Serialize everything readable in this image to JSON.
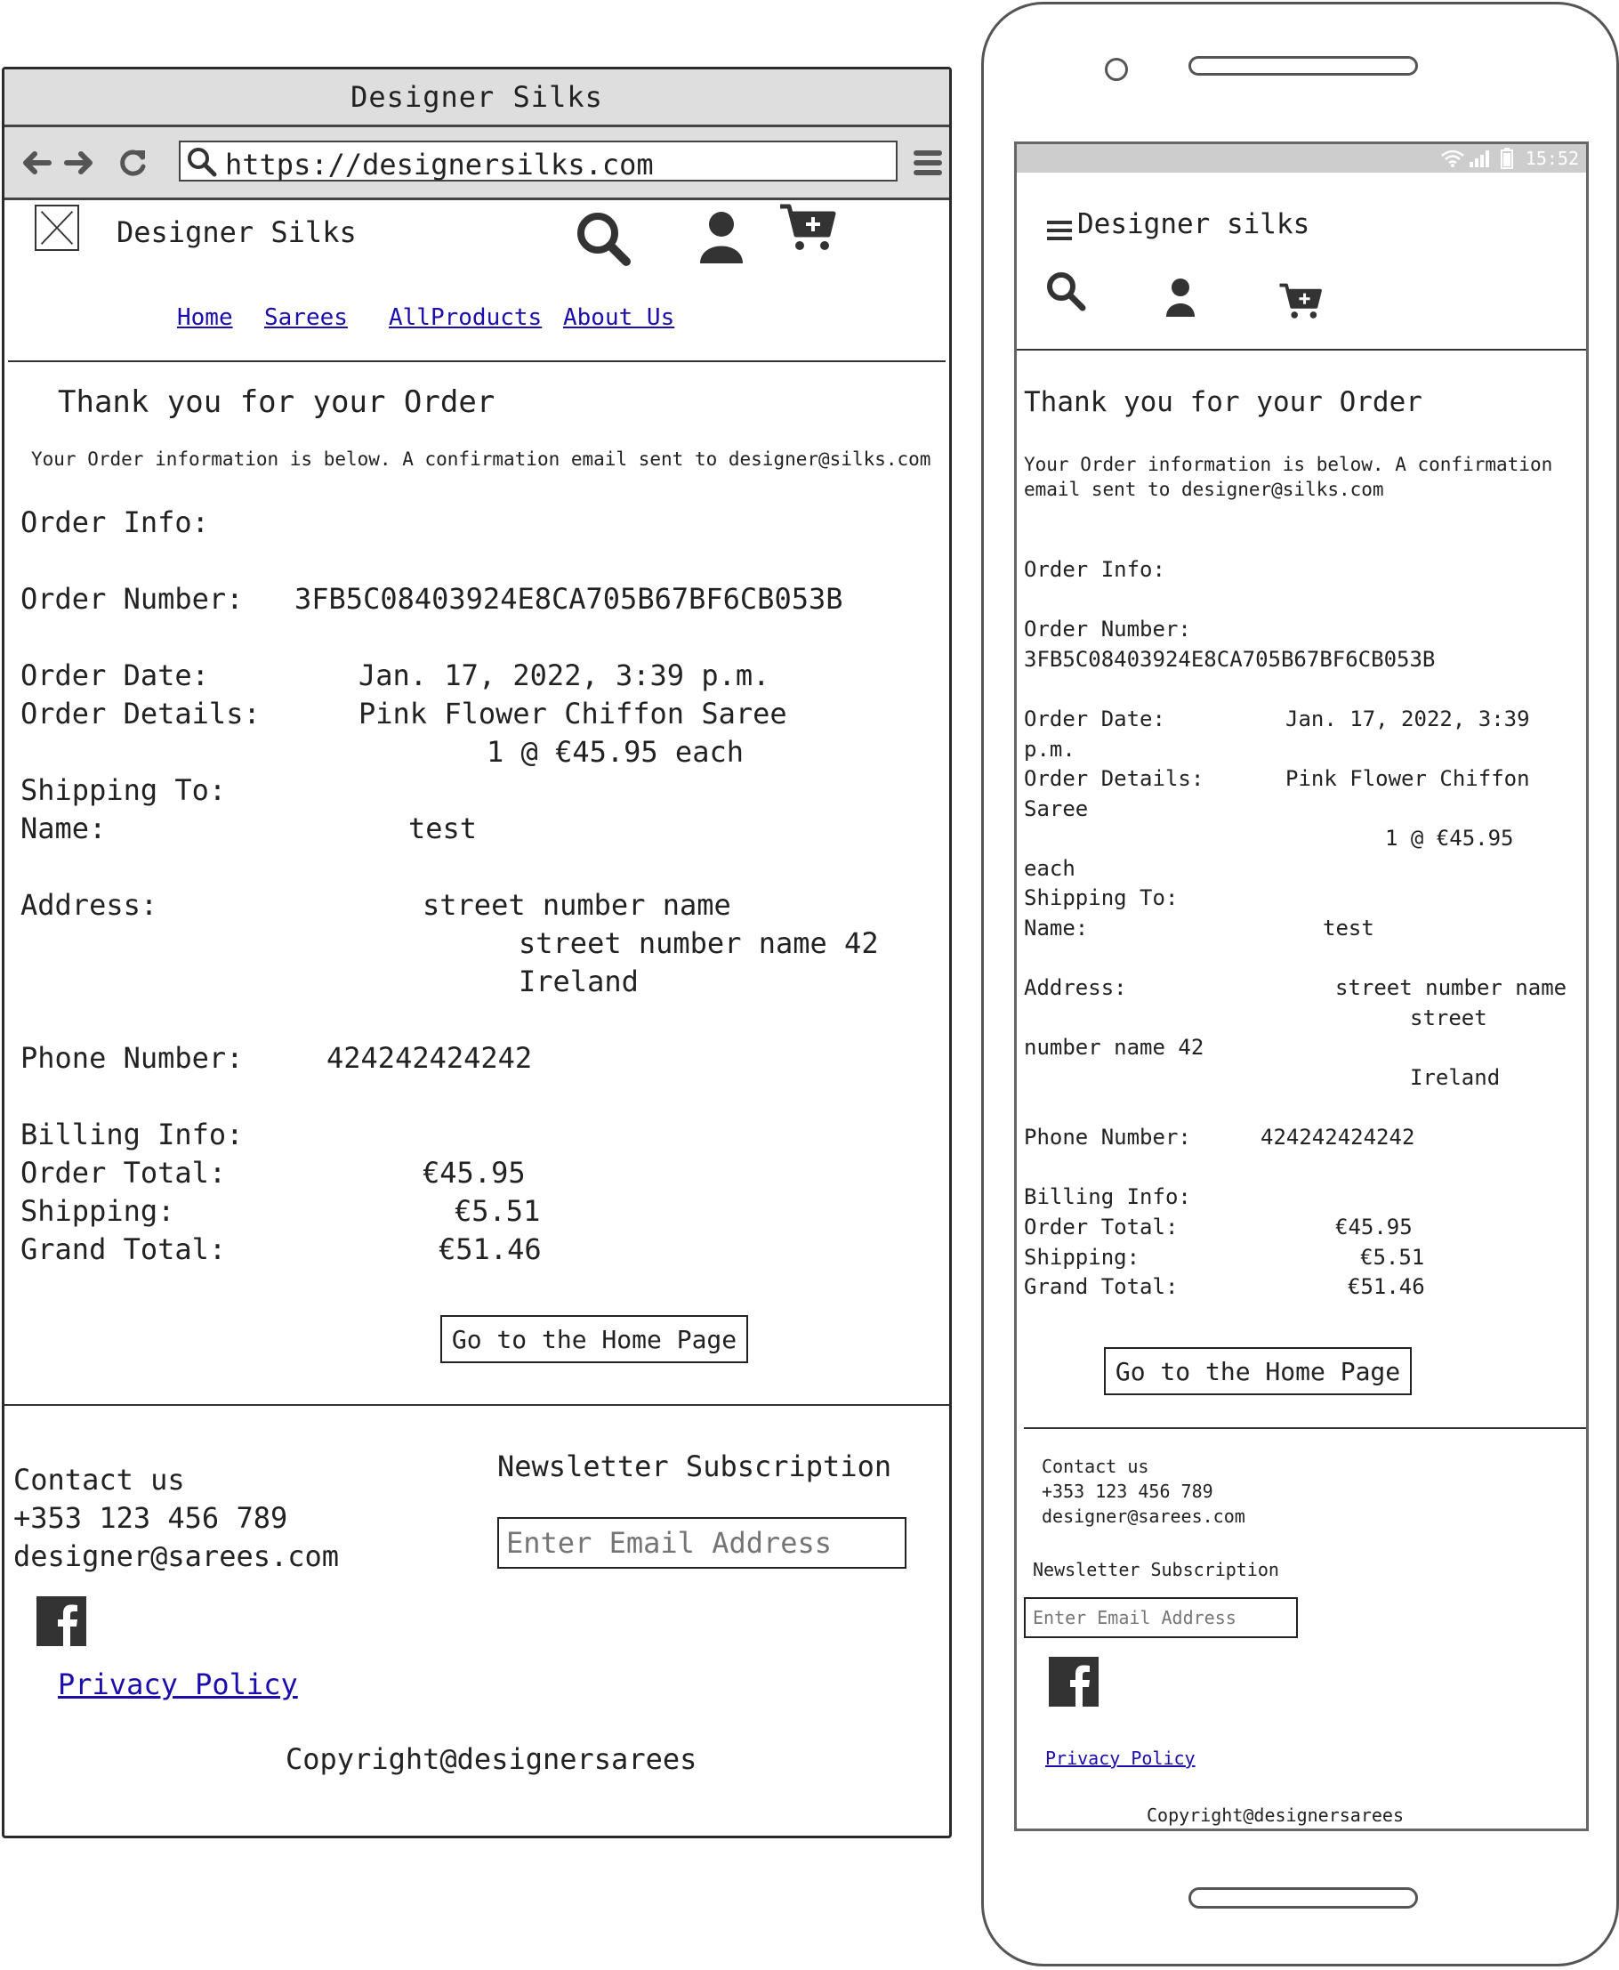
{
  "desktop": {
    "window_title": "Designer Silks",
    "url": "https://designersilks.com",
    "brand": "Designer Silks",
    "nav": [
      "Home",
      "Sarees",
      "AllProducts",
      "About Us"
    ],
    "heading": "Thank you for your Order",
    "intro": "Your Order information is below. A confirmation email sent to designer@silks.com",
    "order": {
      "info_label": "Order Info:",
      "number_label": "Order Number:",
      "number": "3FB5C08403924E8CA705B67BF6CB053B",
      "date_label": "Order Date:",
      "date": "Jan. 17, 2022, 3:39 p.m.",
      "details_label": "Order Details:",
      "item_name": "Pink Flower Chiffon Saree",
      "item_qty": "1 @ €45.95 each",
      "shipping_to_label": "Shipping To:",
      "name_label": "Name:",
      "name": "test",
      "address_label": "Address:",
      "address_line1": "street number name",
      "address_line2": "street number name 42",
      "address_line3": "Ireland",
      "phone_label": "Phone Number:",
      "phone": "424242424242",
      "billing_label": "Billing Info:",
      "total_label": "Order Total:",
      "total": "€45.95",
      "shipping_label": "Shipping:",
      "shipping": "€5.51",
      "grand_label": "Grand Total:",
      "grand": "€51.46"
    },
    "home_button": "Go to the Home Page",
    "footer": {
      "contact_title": "Contact us",
      "contact_phone": "+353 123 456 789",
      "contact_email": "designer@sarees.com",
      "newsletter_title": "Newsletter Subscription",
      "email_placeholder": "Enter Email Address",
      "privacy": "Privacy Policy",
      "copyright": "Copyright@designersarees"
    }
  },
  "mobile": {
    "time": "15:52",
    "brand": "Designer silks",
    "heading": "Thank you for your Order",
    "intro_line1": "Your Order information is below. A confirmation",
    "intro_line2": "email sent to designer@silks.com",
    "order": {
      "info_label": "Order Info:",
      "number_label": "Order Number:",
      "number": "3FB5C08403924E8CA705B67BF6CB053B",
      "date_label": "Order Date:",
      "date_part1": "Jan. 17, 2022, 3:39",
      "date_part2": "p.m.",
      "details_label": "Order Details:",
      "item_part1": "Pink Flower Chiffon",
      "item_part2": "Saree",
      "qty_part1": "1 @ €45.95",
      "qty_part2": "each",
      "shipping_to_label": "Shipping To:",
      "name_label": "Name:",
      "name": "test",
      "address_label": "Address:",
      "address_line1": "street number name",
      "address_line2a": "street",
      "address_line2b": "number name 42",
      "address_line3": "Ireland",
      "phone_label": "Phone Number:",
      "phone": "424242424242",
      "billing_label": "Billing Info:",
      "total_label": "Order Total:",
      "total": "€45.95",
      "shipping_label": "Shipping:",
      "shipping": "€5.51",
      "grand_label": "Grand Total:",
      "grand": "€51.46"
    },
    "home_button": "Go to the Home Page",
    "footer": {
      "contact_title": "Contact us",
      "contact_phone": "+353 123 456 789",
      "contact_email": "designer@sarees.com",
      "newsletter_title": "Newsletter Subscription",
      "email_placeholder": "Enter Email Address",
      "privacy": "Privacy Policy",
      "copyright": "Copyright@designersarees"
    }
  },
  "icons": [
    "back-icon",
    "forward-icon",
    "reload-icon",
    "search-icon",
    "menu-icon",
    "user-icon",
    "cart-plus-icon",
    "facebook-icon",
    "wifi-icon",
    "signal-icon",
    "battery-icon",
    "hamburger-icon",
    "logo-placeholder-icon"
  ],
  "colors": {
    "link": "#1a0dab",
    "chrome": "#dedede",
    "icon": "#333333",
    "status_bar": "#cdcdcd"
  }
}
